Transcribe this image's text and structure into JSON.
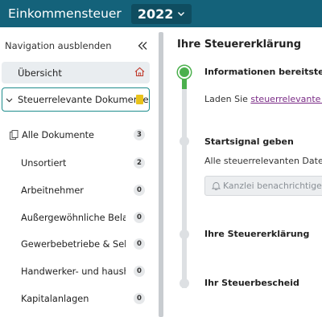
{
  "header": {
    "title": "Einkommensteuer",
    "year": "2022"
  },
  "sidebar": {
    "toggle_label": "Navigation ausblenden",
    "overview_label": "Übersicht",
    "docs_label": "Steuerrelevante Dokumente",
    "all_docs": {
      "label": "Alle Dokumente",
      "count": "3"
    },
    "categories": [
      {
        "label": "Unsortiert",
        "count": "2"
      },
      {
        "label": "Arbeitnehmer",
        "count": "0"
      },
      {
        "label": "Außergewöhnliche Belast…",
        "count": "0"
      },
      {
        "label": "Gewerbebetriebe & Selbst…",
        "count": "0"
      },
      {
        "label": "Handwerker- und haushal…",
        "count": "0"
      },
      {
        "label": "Kapitalanlagen",
        "count": "0"
      }
    ]
  },
  "main": {
    "title": "Ihre Steuererklärung",
    "steps": [
      {
        "title": "Informationen bereitstellen",
        "text_prefix": "Laden Sie ",
        "link": "steuerrelevante Dokumente"
      },
      {
        "title": "Startsignal geben",
        "text": "Alle steuerrelevanten Daten erfasst?",
        "button": "Kanzlei benachrichtigen"
      },
      {
        "title": "Ihre Steuererklärung"
      },
      {
        "title": "Ihr Steuerbescheid"
      }
    ]
  },
  "colors": {
    "header": "#14627a",
    "accent": "#4bb04d",
    "link": "#7a2b86",
    "focus_border": "#1e8c8c"
  }
}
